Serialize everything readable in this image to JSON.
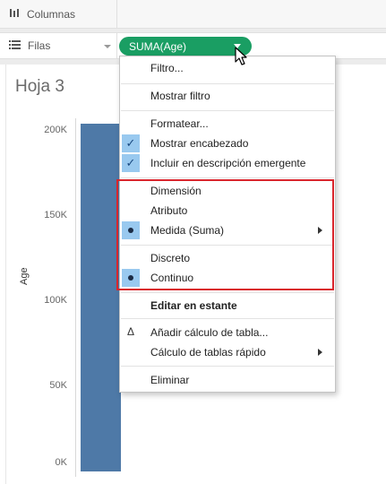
{
  "shelves": {
    "columns_label": "Columnas",
    "rows_label": "Filas",
    "pill_label": "SUMA(Age)",
    "columns_icon": "columns-icon",
    "rows_icon": "rows-icon",
    "pill_color": "#1a9e63"
  },
  "sheet": {
    "title": "Hoja 3",
    "y_axis_title": "Age",
    "ticks": [
      "200K",
      "150K",
      "100K",
      "50K",
      "0K"
    ]
  },
  "chart_data": {
    "type": "bar",
    "categories": [
      ""
    ],
    "values": [
      204000
    ],
    "title": "",
    "xlabel": "",
    "ylabel": "Age",
    "ylim": [
      0,
      200000
    ],
    "ytick_labels": [
      "0K",
      "50K",
      "100K",
      "150K",
      "200K"
    ],
    "bar_color": "#4e79a7"
  },
  "menu": {
    "filter": "Filtro...",
    "show_filter": "Mostrar filtro",
    "format": "Formatear...",
    "show_header": "Mostrar encabezado",
    "include_tooltip": "Incluir en descripción emergente",
    "dimension": "Dimensión",
    "attribute": "Atributo",
    "measure": "Medida (Suma)",
    "discrete": "Discreto",
    "continuous": "Continuo",
    "edit_shelf": "Editar en estante",
    "add_table_calc": "Añadir cálculo de tabla...",
    "quick_table_calc": "Cálculo de tablas rápido",
    "remove": "Eliminar",
    "highlight_color": "#d9252c",
    "check_bg": "#99c9ef"
  }
}
